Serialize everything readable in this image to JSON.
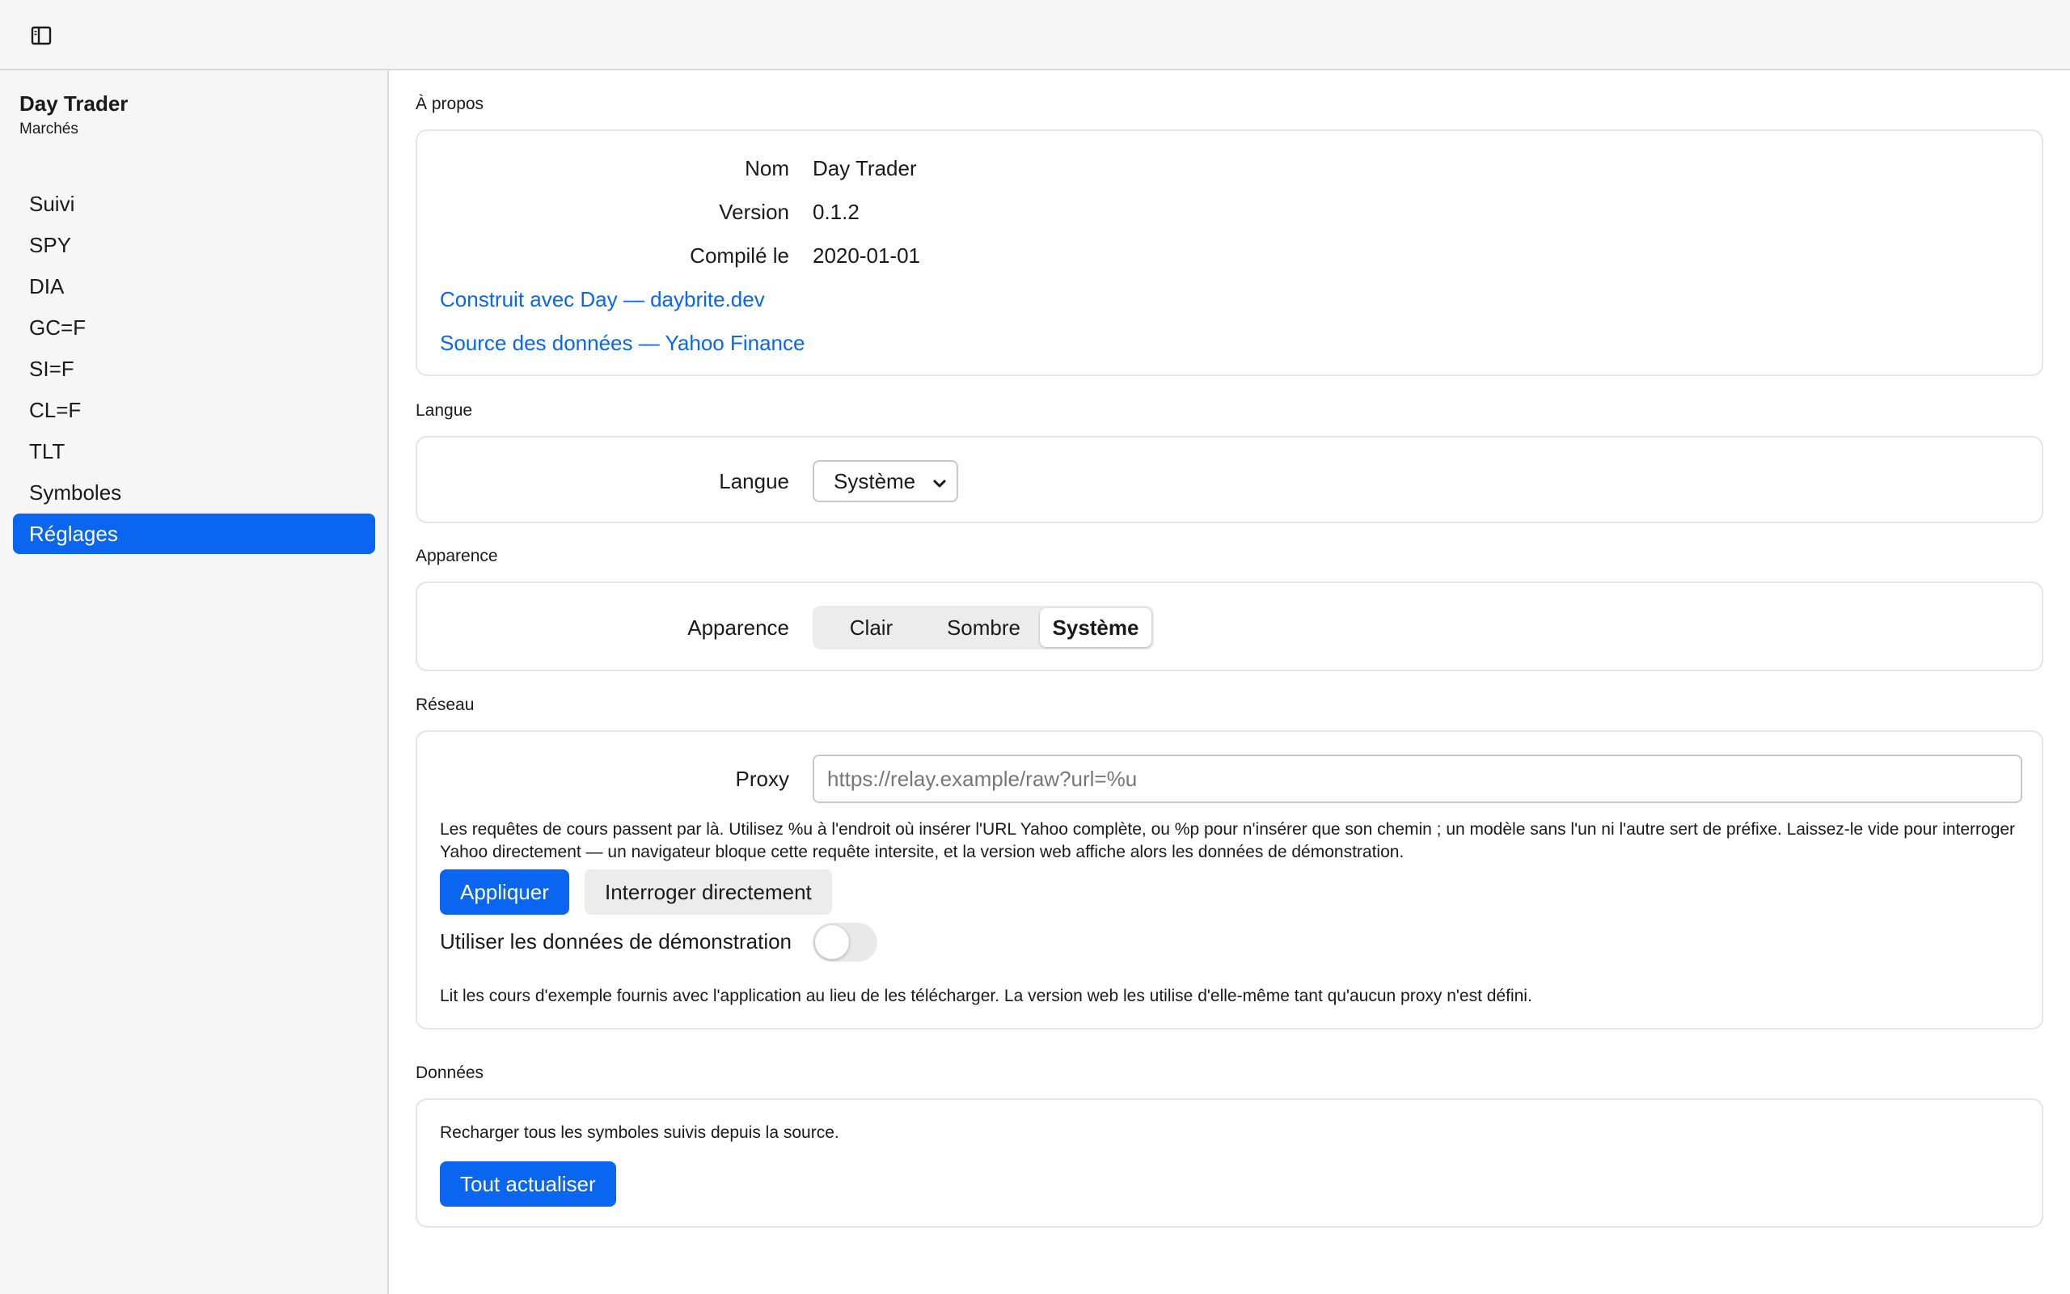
{
  "window": {
    "sidebar_toggle_icon": "sidebar-panel-icon"
  },
  "sidebar": {
    "title": "Day Trader",
    "subtitle": "Marchés",
    "items": [
      {
        "label": "Suivi"
      },
      {
        "label": "SPY"
      },
      {
        "label": "DIA"
      },
      {
        "label": "GC=F"
      },
      {
        "label": "SI=F"
      },
      {
        "label": "CL=F"
      },
      {
        "label": "TLT"
      },
      {
        "label": "Symboles"
      },
      {
        "label": "Réglages"
      }
    ],
    "active_item": "Réglages",
    "accent_color": "#0a66f0"
  },
  "about": {
    "section_label": "À propos",
    "name_label": "Nom",
    "name_value": "Day Trader",
    "version_label": "Version",
    "version_value": "0.1.2",
    "compiled_label": "Compilé le",
    "compiled_value": "2020-01-01",
    "built_with_link": "Construit avec Day — daybrite.dev",
    "data_source_link": "Source des données — Yahoo Finance"
  },
  "language": {
    "section_label": "Langue",
    "field_label": "Langue",
    "selected": "Système"
  },
  "appearance": {
    "section_label": "Apparence",
    "field_label": "Apparence",
    "options": [
      "Clair",
      "Sombre",
      "Système"
    ],
    "selected": "Système"
  },
  "network": {
    "section_label": "Réseau",
    "proxy_label": "Proxy",
    "proxy_value": "",
    "proxy_placeholder": "https://relay.example/raw?url=%u",
    "proxy_help_line1": "Les requêtes de cours passent par là. Utilisez %u à l'endroit où insérer l'URL Yahoo complète, ou %p pour n'insérer que son chemin ; un modèle sans l'un ni l'autre sert de préfixe. Laissez-le vide pour interroger",
    "proxy_help_line2": "Yahoo directement — un navigateur bloque cette requête intersite, et la version web affiche alors les données de démonstration.",
    "apply_button": "Appliquer",
    "direct_button": "Interroger directement",
    "demo_label": "Utiliser les données de démonstration",
    "demo_enabled": false,
    "demo_help": "Lit les cours d'exemple fournis avec l'application au lieu de les télécharger. La version web les utilise d'elle-même tant qu'aucun proxy n'est défini."
  },
  "data": {
    "section_label": "Données",
    "description": "Recharger tous les symboles suivis depuis la source.",
    "refresh_button": "Tout actualiser"
  }
}
